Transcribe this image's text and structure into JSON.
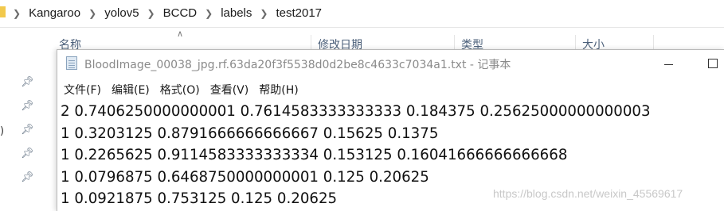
{
  "explorer": {
    "breadcrumb": [
      "Kangaroo",
      "yolov5",
      "BCCD",
      "labels",
      "test2017"
    ],
    "columns": {
      "name": "名称",
      "modified": "修改日期",
      "type": "类型",
      "size": "大小"
    },
    "side_fragment": ")"
  },
  "notepad": {
    "title": "BloodImage_00038_jpg.rf.63da20f3f5538d0d2be8c4633c7034a1.txt - 记事本",
    "menu": [
      "文件(F)",
      "编辑(E)",
      "格式(O)",
      "查看(V)",
      "帮助(H)"
    ],
    "lines": [
      "2 0.7406250000000001 0.7614583333333333 0.184375 0.25625000000000003",
      "1 0.3203125 0.8791666666666667 0.15625 0.1375",
      "1 0.2265625 0.9114583333333334 0.153125 0.16041666666666668",
      "1 0.0796875 0.6468750000000001 0.125 0.20625",
      "1 0.0921875 0.753125 0.125 0.20625"
    ]
  },
  "watermark": "https://blog.csdn.net/weixin_45569617"
}
